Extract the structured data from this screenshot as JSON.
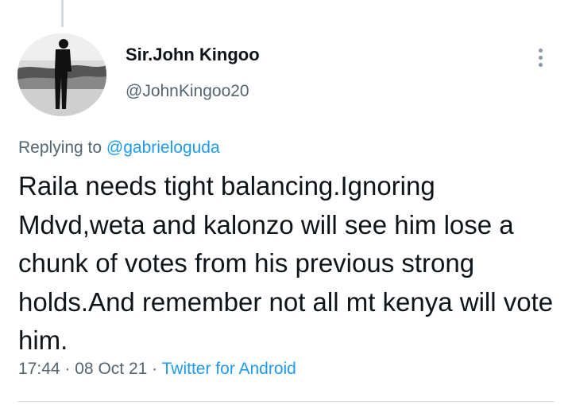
{
  "tweet": {
    "author": {
      "display_name": "Sir.John Kingoo",
      "handle": "@JohnKingoo20"
    },
    "replying_prefix": "Replying to",
    "replying_to": "@gabrieloguda",
    "text": "Raila needs tight balancing.Ignoring Mdvd,weta and kalonzo will see him lose a chunk of votes from his previous strong holds.And remember not all mt kenya will vote him.",
    "time": "17:44",
    "date": "08 Oct 21",
    "separator": "·",
    "source": "Twitter for Android"
  },
  "icons": {
    "more": "more-vertical-icon"
  },
  "colors": {
    "text": "#0f1419",
    "secondary": "#536471",
    "link": "#1d9bf0"
  }
}
